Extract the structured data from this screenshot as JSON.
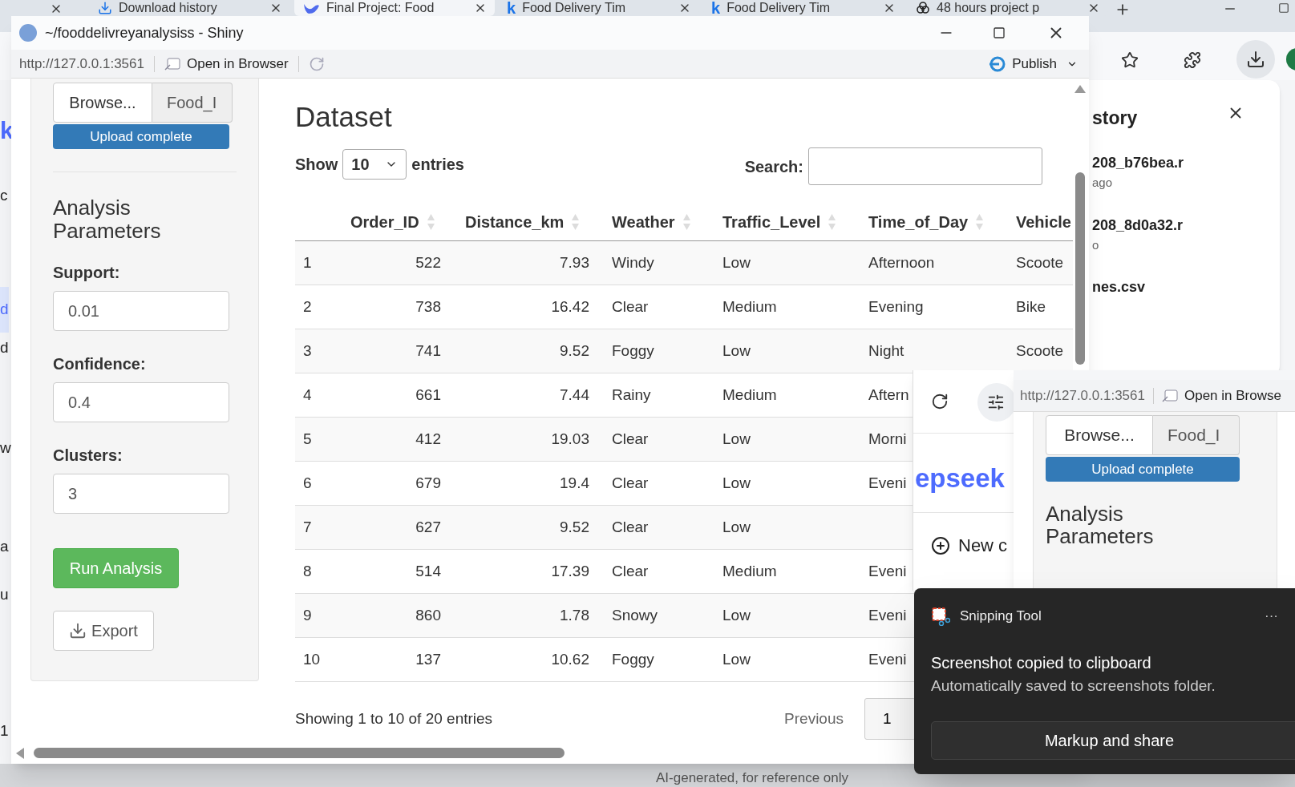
{
  "browser_tabs": [
    {
      "title": "Download history",
      "selected": false
    },
    {
      "title": "Final Project: Food",
      "selected": true
    },
    {
      "title": "Food Delivery Tim",
      "logo": "k",
      "selected": false
    },
    {
      "title": "Food Delivery Tim",
      "logo": "k",
      "selected": false
    },
    {
      "title": "48 hours project p",
      "selected": false
    }
  ],
  "background_page": {
    "fragments": [
      {
        "text": "k",
        "kind": "logo"
      },
      {
        "text": "c",
        "kind": "text"
      },
      {
        "text": "d",
        "kind": "active"
      },
      {
        "text": "d",
        "kind": "text"
      },
      {
        "text": "w",
        "kind": "text"
      },
      {
        "text": "a",
        "kind": "text"
      },
      {
        "text": "u",
        "kind": "text"
      },
      {
        "text": "1",
        "kind": "text"
      }
    ],
    "footer": "AI-generated, for reference only"
  },
  "download_panel": {
    "title": "story",
    "items": [
      {
        "name": "208_b76bea.r",
        "detail": "ago"
      },
      {
        "name": "208_8d0a32.r",
        "detail": "o"
      },
      {
        "name": "nes.csv"
      }
    ]
  },
  "shiny_window": {
    "title": "~/fooddelivreyanalysiss - Shiny",
    "url": "http://127.0.0.1:3561",
    "open_in_browser": "Open in Browser",
    "publish": "Publish",
    "sidebar": {
      "browse": "Browse...",
      "filename": "Food_I",
      "upload": {
        "label": "Upload complete",
        "level": 1
      },
      "heading": "Analysis Parameters",
      "params": [
        {
          "label": "Support:",
          "value": "0.01"
        },
        {
          "label": "Confidence:",
          "value": "0.4"
        },
        {
          "label": "Clusters:",
          "value": "3"
        }
      ],
      "run_button": "Run Analysis",
      "export_button": "Export"
    },
    "main": {
      "title": "Dataset",
      "show": "Show",
      "length": "10",
      "entries": "entries",
      "search_label": "Search:",
      "table": {
        "columns": [
          "",
          "Order_ID",
          "Distance_km",
          "Weather",
          "Traffic_Level",
          "Time_of_Day",
          "Vehicle"
        ],
        "rows": [
          [
            "1",
            "522",
            "7.93",
            "Windy",
            "Low",
            "Afternoon",
            "Scoote"
          ],
          [
            "2",
            "738",
            "16.42",
            "Clear",
            "Medium",
            "Evening",
            "Bike"
          ],
          [
            "3",
            "741",
            "9.52",
            "Foggy",
            "Low",
            "Night",
            "Scoote"
          ],
          [
            "4",
            "661",
            "7.44",
            "Rainy",
            "Medium",
            "Aftern"
          ],
          [
            "5",
            "412",
            "19.03",
            "Clear",
            "Low",
            "Morni"
          ],
          [
            "6",
            "679",
            "19.4",
            "Clear",
            "Low",
            "Eveni"
          ],
          [
            "7",
            "627",
            "9.52",
            "Clear",
            "Low"
          ],
          [
            "8",
            "514",
            "17.39",
            "Clear",
            "Medium",
            "Eveni"
          ],
          [
            "9",
            "860",
            "1.78",
            "Snowy",
            "Low",
            "Eveni"
          ],
          [
            "10",
            "137",
            "10.62",
            "Foggy",
            "Low",
            "Eveni"
          ]
        ]
      },
      "info": "Showing 1 to 10 of 20 entries",
      "previous": "Previous",
      "pages": [
        {
          "label": "1",
          "selected": true
        }
      ]
    }
  },
  "chat_window": {
    "logo": "epseek",
    "new_chat": "New c"
  },
  "shiny_window_2": {
    "url": "http://127.0.0.1:3561",
    "open_in_browser": "Open in Browse",
    "browse": "Browse...",
    "filename": "Food_I",
    "upload": {
      "label": "Upload complete",
      "level": 1
    },
    "heading": "Analysis Parameters"
  },
  "toast": {
    "app": "Snipping Tool",
    "more": "···",
    "title": "Screenshot copied to clipboard",
    "body": "Automatically saved to screenshots folder.",
    "action": "Markup and share"
  }
}
